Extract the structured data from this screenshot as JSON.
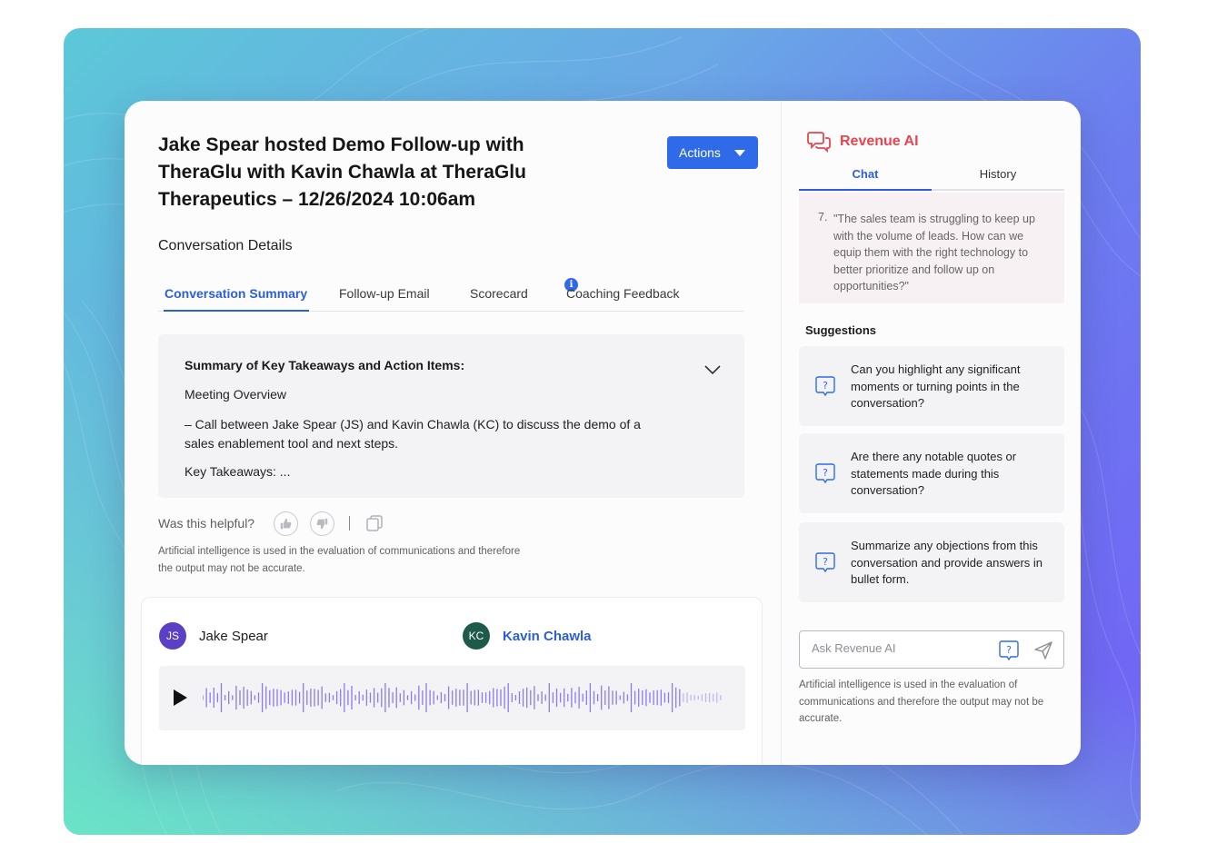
{
  "meeting": {
    "title": "Jake Spear hosted Demo Follow-up with TheraGlu with Kavin Chawla at TheraGlu Therapeutics – 12/26/2024 10:06am",
    "actions_label": "Actions",
    "section_title": "Conversation Details"
  },
  "tabs": [
    {
      "label": "Conversation Summary",
      "active": true
    },
    {
      "label": "Follow-up Email",
      "active": false
    },
    {
      "label": "Scorecard",
      "active": false,
      "badge": "i"
    },
    {
      "label": "Coaching Feedback",
      "active": false
    }
  ],
  "summary": {
    "heading": "Summary of Key Takeaways and Action Items:",
    "overview": "Meeting Overview",
    "detail": "– Call between Jake Spear (JS) and Kavin Chawla (KC) to discuss the demo of a sales enablement tool and next steps.",
    "takeaways": "Key Takeaways: ..."
  },
  "feedback": {
    "question": "Was this helpful?",
    "disclaimer": "Artificial intelligence is used in the evaluation of communications and therefore the output may not be accurate."
  },
  "participants": [
    {
      "initials": "JS",
      "name": "Jake Spear",
      "color": "#5b3fc4"
    },
    {
      "initials": "KC",
      "name": "Kavin Chawla",
      "color": "#1d5a4a"
    }
  ],
  "colors": {
    "accent": "#2f6be8",
    "brand_red": "#e8454f",
    "waveform": "#8d7be8"
  },
  "revenue_ai": {
    "title": "Revenue AI",
    "tabs": [
      {
        "label": "Chat",
        "active": true
      },
      {
        "label": "History",
        "active": false
      }
    ],
    "prior_question_number": "7.",
    "prior_question": "\"The sales team is struggling to keep up with the volume of leads. How can we equip them with the right technology to better prioritize and follow up on opportunities?\"",
    "suggestions_title": "Suggestions",
    "suggestions": [
      "Can you highlight any significant moments or turning points in the conversation?",
      "Are there any notable quotes or statements made during this conversation?",
      "Summarize any objections from this conversation and provide answers in bullet form."
    ],
    "input_placeholder": "Ask Revenue AI",
    "disclaimer": "Artificial intelligence is used in the evaluation of communications and therefore the output may not be accurate."
  }
}
